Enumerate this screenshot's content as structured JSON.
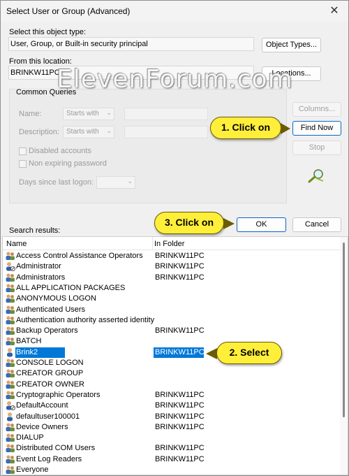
{
  "window": {
    "title": "Select User or Group (Advanced)",
    "close_glyph": "✕"
  },
  "object_type": {
    "label": "Select this object type:",
    "value": "User, Group, or Built-in security principal",
    "button": "Object Types..."
  },
  "location": {
    "label": "From this location:",
    "value": "BRINKW11PC",
    "button": "Locations..."
  },
  "common_queries": {
    "title": "Common Queries",
    "name_label": "Name:",
    "name_mode": "Starts with",
    "description_label": "Description:",
    "description_mode": "Starts with",
    "disabled_accounts": "Disabled accounts",
    "non_expiring": "Non expiring password",
    "days_label": "Days since last logon:"
  },
  "side_buttons": {
    "columns": "Columns...",
    "find_now": "Find Now",
    "stop": "Stop"
  },
  "ok_label": "OK",
  "cancel_label": "Cancel",
  "results": {
    "label": "Search results:",
    "col_name": "Name",
    "col_folder": "In Folder",
    "rows": [
      {
        "name": "Access Control Assistance Operators",
        "folder": "BRINKW11PC",
        "icon": "group"
      },
      {
        "name": "Administrator",
        "folder": "BRINKW11PC",
        "icon": "user-disabled"
      },
      {
        "name": "Administrators",
        "folder": "BRINKW11PC",
        "icon": "group"
      },
      {
        "name": "ALL APPLICATION PACKAGES",
        "folder": "",
        "icon": "group"
      },
      {
        "name": "ANONYMOUS LOGON",
        "folder": "",
        "icon": "group"
      },
      {
        "name": "Authenticated Users",
        "folder": "",
        "icon": "group"
      },
      {
        "name": "Authentication authority asserted identity",
        "folder": "",
        "icon": "group"
      },
      {
        "name": "Backup Operators",
        "folder": "BRINKW11PC",
        "icon": "group"
      },
      {
        "name": "BATCH",
        "folder": "",
        "icon": "group"
      },
      {
        "name": "Brink2",
        "folder": "BRINKW11PC",
        "icon": "user",
        "selected": true
      },
      {
        "name": "CONSOLE LOGON",
        "folder": "",
        "icon": "group"
      },
      {
        "name": "CREATOR GROUP",
        "folder": "",
        "icon": "group"
      },
      {
        "name": "CREATOR OWNER",
        "folder": "",
        "icon": "group"
      },
      {
        "name": "Cryptographic Operators",
        "folder": "BRINKW11PC",
        "icon": "group"
      },
      {
        "name": "DefaultAccount",
        "folder": "BRINKW11PC",
        "icon": "user-disabled"
      },
      {
        "name": "defaultuser100001",
        "folder": "BRINKW11PC",
        "icon": "user"
      },
      {
        "name": "Device Owners",
        "folder": "BRINKW11PC",
        "icon": "group"
      },
      {
        "name": "DIALUP",
        "folder": "",
        "icon": "group"
      },
      {
        "name": "Distributed COM Users",
        "folder": "BRINKW11PC",
        "icon": "group"
      },
      {
        "name": "Event Log Readers",
        "folder": "BRINKW11PC",
        "icon": "group"
      },
      {
        "name": "Everyone",
        "folder": "",
        "icon": "group"
      }
    ]
  },
  "callouts": {
    "step1": "1. Click on",
    "step2": "2. Select",
    "step3": "3. Click on"
  },
  "watermark": "ElevenForum.com",
  "colors": {
    "selection": "#0078d7",
    "callout": "#ffef3a",
    "accent": "#0a64c8"
  }
}
